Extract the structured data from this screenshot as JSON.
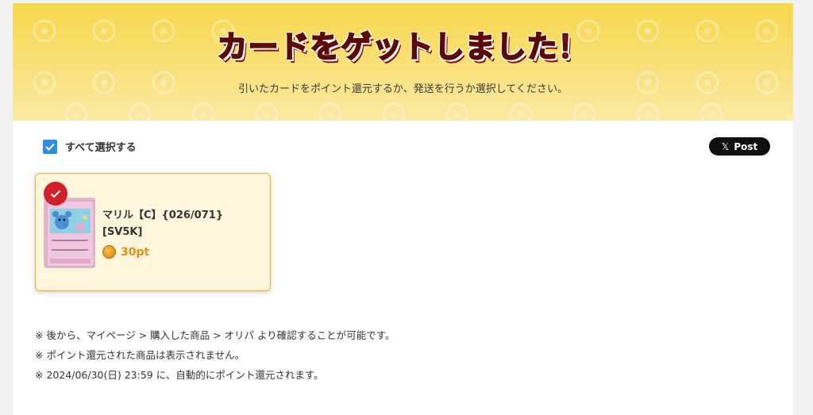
{
  "hero": {
    "title": "カードをゲットしました！",
    "subtitle": "引いたカードをポイント還元するか、発送を行うか選択してください。"
  },
  "select_all": {
    "label": "すべて選択する",
    "checked": true
  },
  "share": {
    "label": "Post",
    "icon": "x-logo-icon"
  },
  "cards": [
    {
      "name_line1": "マリル【C】{026/071}",
      "name_line2": "[SV5K]",
      "points": "30pt",
      "selected": true
    }
  ],
  "notes": [
    "※ 後から、マイページ > 購入した商品 > オリパ より確認することが可能です。",
    "※ ポイント還元された商品は表示されません。",
    "※ 2024/06/30(日) 23:59 に、自動的にポイント還元されます。"
  ],
  "colors": {
    "hero_yellow": "#f7d84a",
    "title_red": "#e81e25",
    "checkbox_blue": "#2f8fe0",
    "card_border": "#e8b22c",
    "points_orange": "#e0901a",
    "badge_red": "#d2202a"
  }
}
